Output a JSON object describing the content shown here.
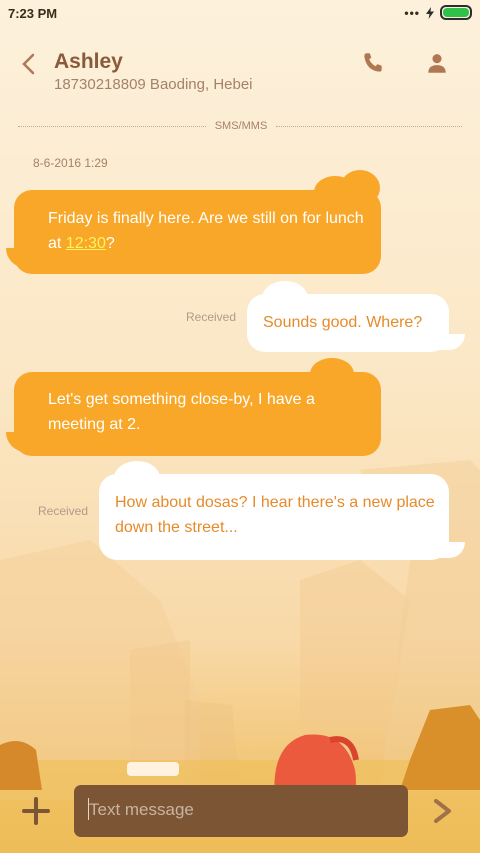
{
  "status": {
    "time": "7:23 PM",
    "more": "•••"
  },
  "header": {
    "name": "Ashley",
    "subtitle": "18730218809 Baoding, Hebei"
  },
  "thread": {
    "channel": "SMS/MMS",
    "date": "8-6-2016 1:29",
    "messages": [
      {
        "direction": "sent",
        "text_before": "Friday is finally here. Are we still on for lunch at ",
        "link": "12:30",
        "text_after": "?"
      },
      {
        "direction": "received",
        "status": "Received",
        "text": "Sounds good. Where?"
      },
      {
        "direction": "sent",
        "text": "Let's get something close-by, I have a meeting at 2."
      },
      {
        "direction": "received",
        "status": "Received",
        "text": "How about dosas? I hear there's a new place down the street..."
      }
    ]
  },
  "composer": {
    "placeholder": "Text message"
  },
  "colors": {
    "sent_bubble": "#f9a728",
    "received_text": "#e78a2a",
    "name": "#8a5a3a",
    "battery": "#2fc24a",
    "input_bg": "#7c5535"
  },
  "icons": [
    "back-icon",
    "phone-icon",
    "contact-icon",
    "plus-icon",
    "send-icon",
    "battery-icon",
    "charging-icon"
  ]
}
